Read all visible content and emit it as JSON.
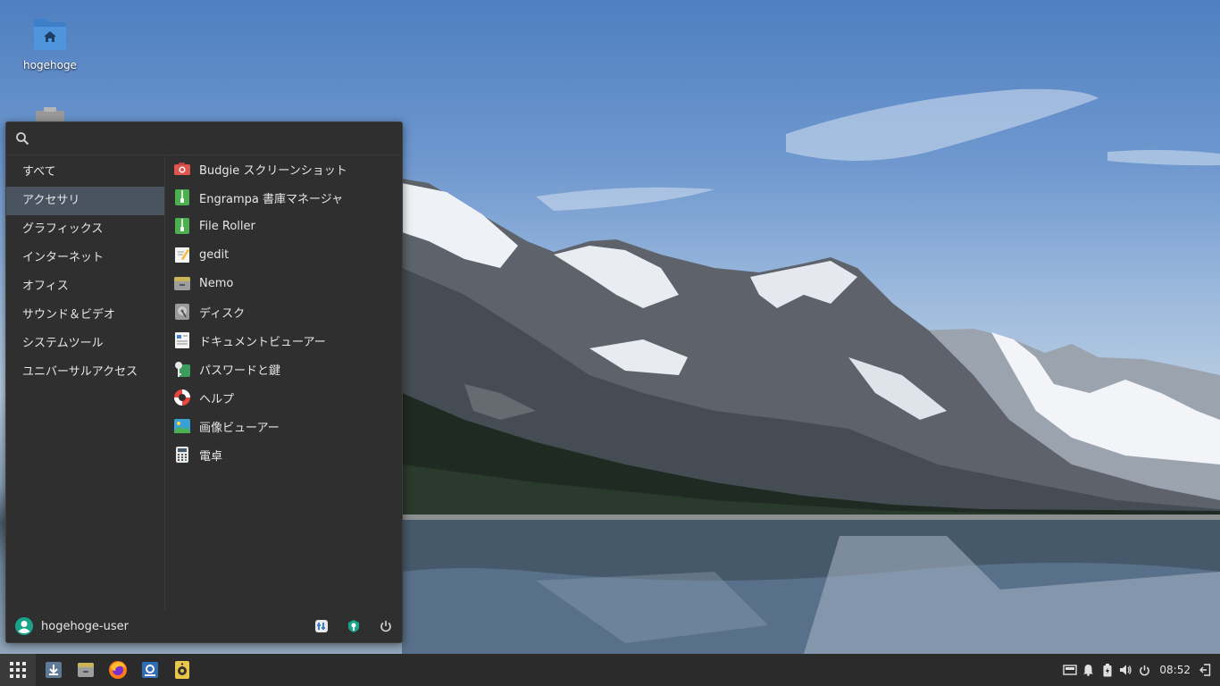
{
  "desktop": {
    "icons": [
      {
        "label": "hogehoge",
        "icon": "home-folder-icon"
      },
      {
        "label": "",
        "icon": "trash-icon"
      }
    ]
  },
  "menu": {
    "search": {
      "value": "",
      "placeholder": ""
    },
    "categories": [
      {
        "label": "すべて",
        "active": false
      },
      {
        "label": "アクセサリ",
        "active": true
      },
      {
        "label": "グラフィックス",
        "active": false
      },
      {
        "label": "インターネット",
        "active": false
      },
      {
        "label": "オフィス",
        "active": false
      },
      {
        "label": "サウンド＆ビデオ",
        "active": false
      },
      {
        "label": "システムツール",
        "active": false
      },
      {
        "label": "ユニバーサルアクセス",
        "active": false
      }
    ],
    "apps": [
      {
        "label": "Budgie スクリーンショット",
        "icon": "camera-icon"
      },
      {
        "label": "Engrampa 書庫マネージャ",
        "icon": "archive-icon"
      },
      {
        "label": "File Roller",
        "icon": "archive-icon"
      },
      {
        "label": "gedit",
        "icon": "text-editor-icon"
      },
      {
        "label": "Nemo",
        "icon": "file-manager-icon"
      },
      {
        "label": "ディスク",
        "icon": "disks-icon"
      },
      {
        "label": "ドキュメントビューアー",
        "icon": "document-viewer-icon"
      },
      {
        "label": "パスワードと鍵",
        "icon": "keys-icon"
      },
      {
        "label": "ヘルプ",
        "icon": "help-lifebuoy-icon"
      },
      {
        "label": "画像ビューアー",
        "icon": "image-viewer-icon"
      },
      {
        "label": "電卓",
        "icon": "calculator-icon"
      }
    ],
    "footer": {
      "user": "hogehoge-user",
      "buttons": [
        "settings-icon",
        "system-icon",
        "power-icon"
      ]
    }
  },
  "taskbar": {
    "apps": [
      "downloads-icon",
      "file-manager-icon",
      "firefox-icon",
      "software-center-icon",
      "speaker-app-icon"
    ],
    "tray": [
      "network-icon",
      "notification-bell-icon",
      "battery-icon",
      "volume-icon",
      "power-icon"
    ],
    "clock": "08:52"
  },
  "colors": {
    "accent": "#4a5360",
    "panel": "#2b2b2b",
    "menu_bg": "#2f2f2f"
  }
}
